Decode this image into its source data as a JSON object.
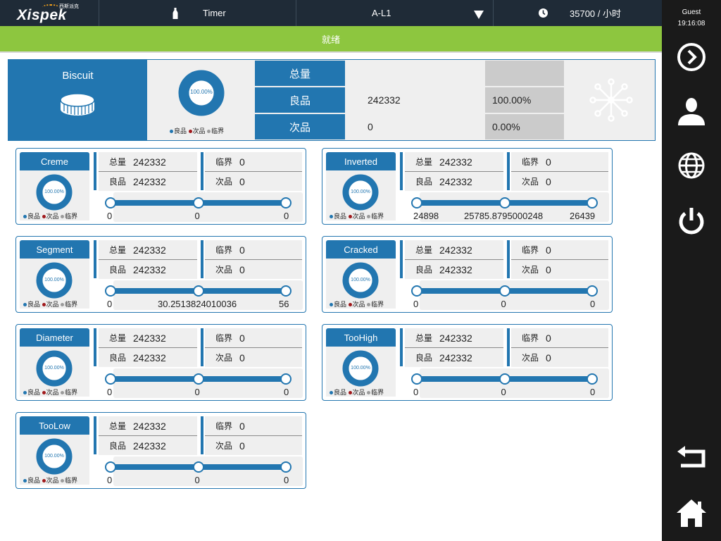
{
  "topbar": {
    "brand": "Xispek",
    "brand_sub": "西斯派克",
    "timer_label": "Timer",
    "line_label": "A-L1",
    "rate_label": "35700 / 小时"
  },
  "status": {
    "text": "就绪"
  },
  "user": {
    "name": "Guest",
    "time": "19:16:08"
  },
  "summary": {
    "product": "Biscuit",
    "donut_text": "100.00%",
    "rows": [
      {
        "label": "总量",
        "value": "",
        "percent": ""
      },
      {
        "label": "良品",
        "value": "242332",
        "percent": "100.00%"
      },
      {
        "label": "次品",
        "value": "0",
        "percent": "0.00%"
      }
    ]
  },
  "legend": {
    "good": "良品",
    "bad": "次品",
    "critical": "临界"
  },
  "colors": {
    "primary": "#2276b0",
    "status_green": "#8dc63f",
    "topbar": "#1f2b37",
    "sidebar": "#1a1a1a",
    "bad": "#a0191c",
    "critical": "#9b9b9b"
  },
  "cards": [
    {
      "name": "Creme",
      "total_label": "总量",
      "total": "242332",
      "good_label": "良品",
      "good": "242332",
      "crit_label": "临界",
      "crit": "0",
      "bad_label": "次品",
      "bad": "0",
      "donut_text": "100.00%",
      "min": "0",
      "mid": "0",
      "max": "0"
    },
    {
      "name": "Inverted",
      "total_label": "总量",
      "total": "242332",
      "good_label": "良品",
      "good": "242332",
      "crit_label": "临界",
      "crit": "0",
      "bad_label": "次品",
      "bad": "0",
      "donut_text": "100.00%",
      "min": "24898",
      "mid": "25785.8795000248",
      "max": "26439"
    },
    {
      "name": "Segment",
      "total_label": "总量",
      "total": "242332",
      "good_label": "良品",
      "good": "242332",
      "crit_label": "临界",
      "crit": "0",
      "bad_label": "次品",
      "bad": "0",
      "donut_text": "100.00%",
      "min": "0",
      "mid": "30.2513824010036",
      "max": "56"
    },
    {
      "name": "Cracked",
      "total_label": "总量",
      "total": "242332",
      "good_label": "良品",
      "good": "242332",
      "crit_label": "临界",
      "crit": "0",
      "bad_label": "次品",
      "bad": "0",
      "donut_text": "100.00%",
      "min": "0",
      "mid": "0",
      "max": "0"
    },
    {
      "name": "Diameter",
      "total_label": "总量",
      "total": "242332",
      "good_label": "良品",
      "good": "242332",
      "crit_label": "临界",
      "crit": "0",
      "bad_label": "次品",
      "bad": "0",
      "donut_text": "100.00%",
      "min": "0",
      "mid": "0",
      "max": "0"
    },
    {
      "name": "TooHigh",
      "total_label": "总量",
      "total": "242332",
      "good_label": "良品",
      "good": "242332",
      "crit_label": "临界",
      "crit": "0",
      "bad_label": "次品",
      "bad": "0",
      "donut_text": "100.00%",
      "min": "0",
      "mid": "0",
      "max": "0"
    },
    {
      "name": "TooLow",
      "total_label": "总量",
      "total": "242332",
      "good_label": "良品",
      "good": "242332",
      "crit_label": "临界",
      "crit": "0",
      "bad_label": "次品",
      "bad": "0",
      "donut_text": "100.00%",
      "min": "0",
      "mid": "0",
      "max": "0"
    }
  ],
  "sidebar_buttons": [
    "next-icon",
    "user-icon",
    "globe-icon",
    "power-icon",
    "back-icon",
    "home-icon"
  ]
}
